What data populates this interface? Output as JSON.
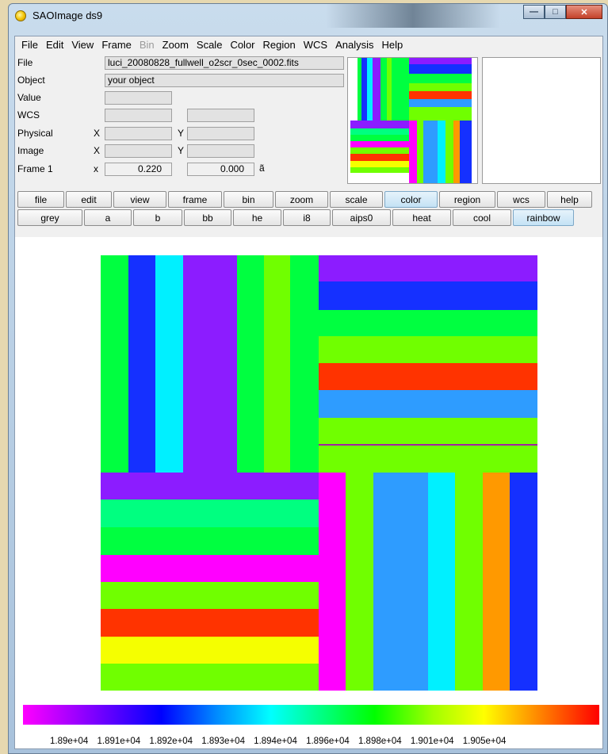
{
  "window": {
    "title": "SAOImage ds9"
  },
  "menubar": [
    "File",
    "Edit",
    "View",
    "Frame",
    "Bin",
    "Zoom",
    "Scale",
    "Color",
    "Region",
    "WCS",
    "Analysis",
    "Help"
  ],
  "info": {
    "file_label": "File",
    "file_value": "luci_20080828_fullwell_o2scr_0sec_0002.fits",
    "object_label": "Object",
    "object_value": "your object",
    "value_label": "Value",
    "wcs_label": "WCS",
    "physical_label": "Physical",
    "image_label": "Image",
    "frame_label": "Frame 1",
    "x_label": "X",
    "y_label": "Y",
    "x_lower": "x",
    "frame_x_value": "0.220",
    "frame_y_value": "0.000",
    "angle_symbol": "ã"
  },
  "buttons_main": [
    "file",
    "edit",
    "view",
    "frame",
    "bin",
    "zoom",
    "scale",
    "color",
    "region",
    "wcs",
    "help"
  ],
  "buttons_color": [
    "grey",
    "a",
    "b",
    "bb",
    "he",
    "i8",
    "aips0",
    "heat",
    "cool",
    "rainbow"
  ],
  "active_main": "color",
  "active_color": "rainbow",
  "colorbar_ticks": [
    "1.89e+04",
    "1.891e+04",
    "1.892e+04",
    "1.893e+04",
    "1.894e+04",
    "1.896e+04",
    "1.898e+04",
    "1.901e+04",
    "1.905e+04"
  ],
  "colors": {
    "magenta": "#ff00ff",
    "purple": "#8c1cff",
    "blue": "#1530ff",
    "cyan": "#00f0ff",
    "green": "#00ff40",
    "lime": "#70ff00",
    "yellow": "#f5ff00",
    "orange": "#ff9900",
    "red": "#ff3300"
  }
}
